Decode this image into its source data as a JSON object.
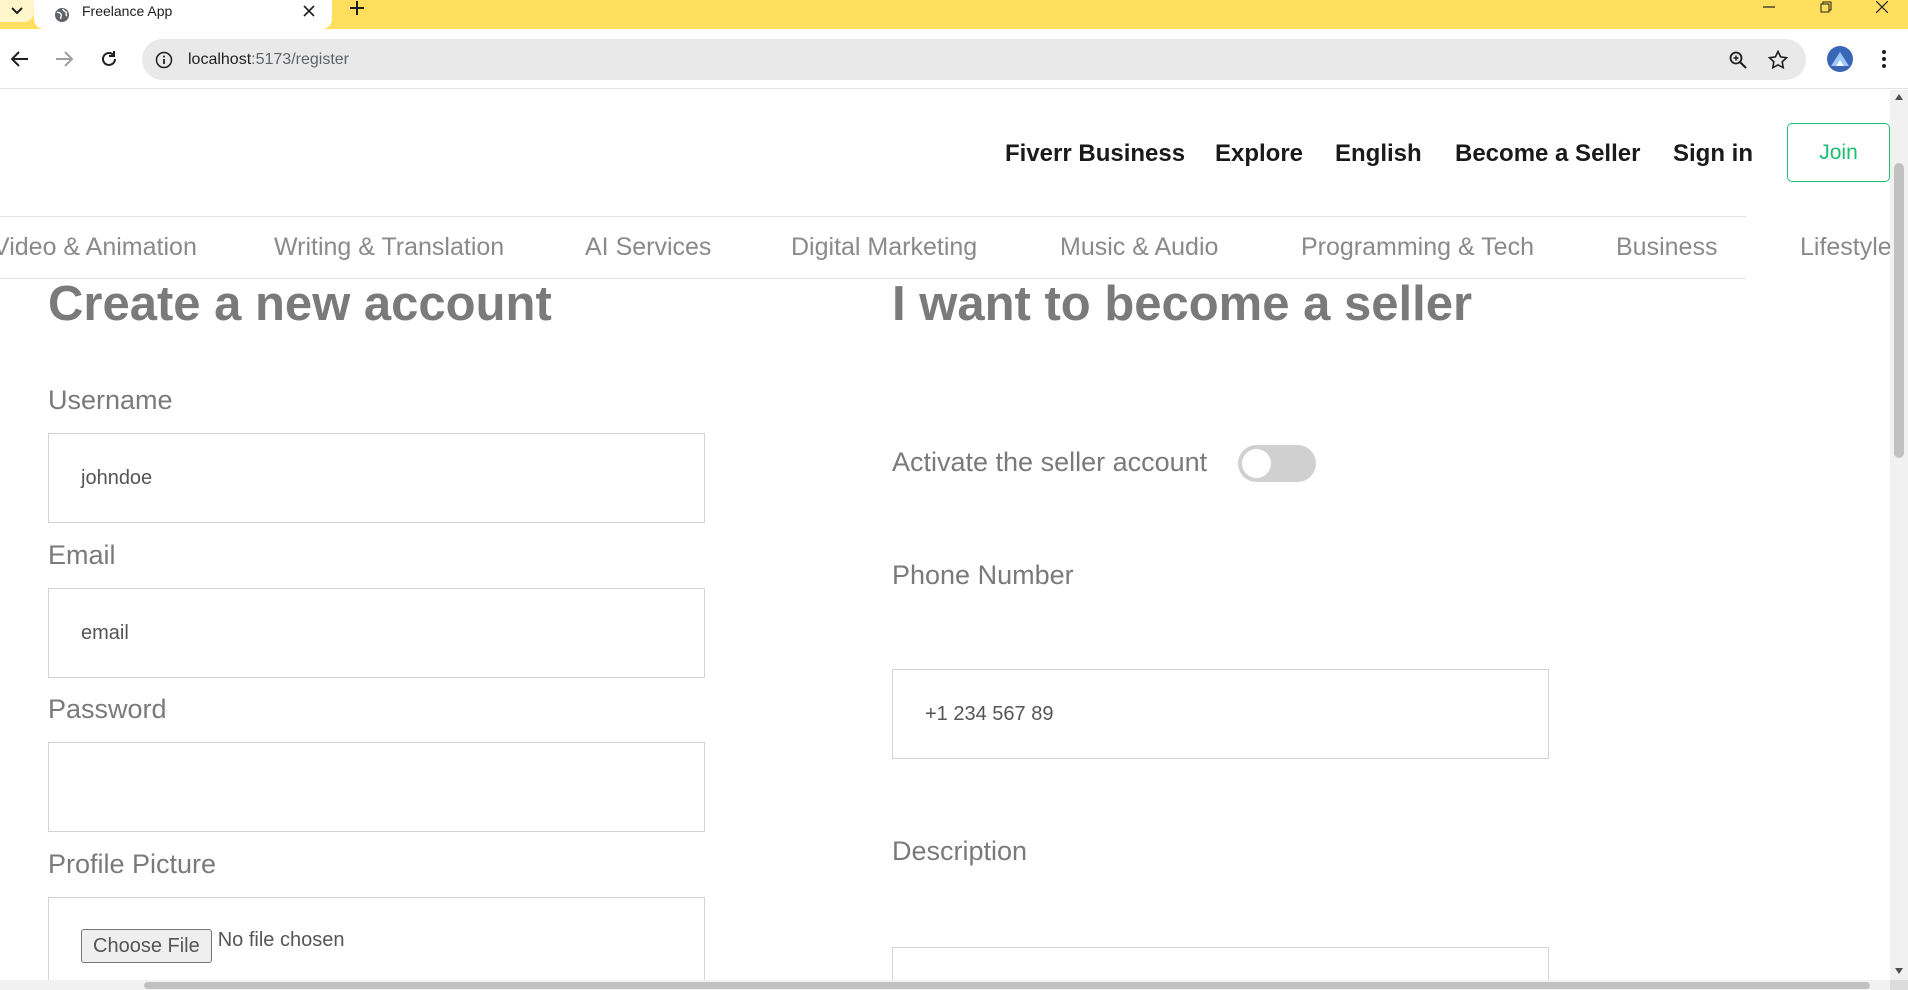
{
  "browser": {
    "tab_title": "Freelance App",
    "url_host": "localhost",
    "url_path": ":5173/register",
    "accent": "#ffdf5d"
  },
  "nav": {
    "links": [
      "Fiverr Business",
      "Explore",
      "English",
      "Become a Seller",
      "Sign in"
    ],
    "join_label": "Join",
    "brand_color": "#1dbf73"
  },
  "categories": [
    "Video & Animation",
    "Writing & Translation",
    "AI Services",
    "Digital Marketing",
    "Music & Audio",
    "Programming & Tech",
    "Business",
    "Lifestyle"
  ],
  "left": {
    "title": "Create a new account",
    "username_label": "Username",
    "username_placeholder": "johndoe",
    "email_label": "Email",
    "email_placeholder": "email",
    "password_label": "Password",
    "password_value": "",
    "picture_label": "Profile Picture",
    "file_button": "Choose File",
    "file_status": "No file chosen"
  },
  "right": {
    "title": "I want to become a seller",
    "activate_label": "Activate the seller account",
    "seller_active": false,
    "phone_label": "Phone Number",
    "phone_placeholder": "+1 234 567 89",
    "description_label": "Description"
  }
}
